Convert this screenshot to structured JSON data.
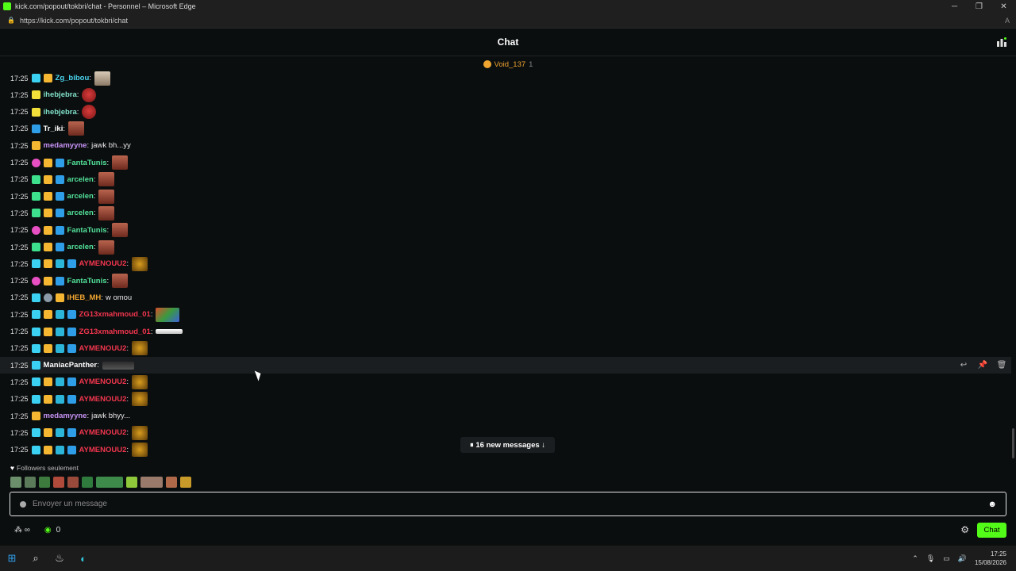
{
  "window": {
    "title": "kick.com/popout/tokbri/chat - Personnel – Microsoft Edge",
    "url": "https://kick.com/popout/tokbri/chat"
  },
  "chat": {
    "title": "Chat",
    "pinned_user": "Void_137",
    "pinned_count": "1"
  },
  "messages": [
    {
      "time": "17:25",
      "badges": [
        "b-sub",
        "b-gold"
      ],
      "user": "Zg_bibou",
      "color": "#4ad6f0",
      "text": "",
      "emote": "pale"
    },
    {
      "time": "17:25",
      "badges": [
        "b-yellow"
      ],
      "user": "ihebjebra",
      "color": "#7fe0c8",
      "text": "",
      "emote": "red"
    },
    {
      "time": "17:25",
      "badges": [
        "b-yellow"
      ],
      "user": "ihebjebra",
      "color": "#7fe0c8",
      "text": "",
      "emote": "red"
    },
    {
      "time": "17:25",
      "badges": [
        "b-blue"
      ],
      "user": "Tr_iki",
      "color": "#ffffff",
      "text": "",
      "emote": "face"
    },
    {
      "time": "17:25",
      "badges": [
        "b-gold"
      ],
      "user": "medamyyne",
      "color": "#c793f5",
      "text": "jawk bh...yy",
      "emote": ""
    },
    {
      "time": "17:25",
      "badges": [
        "b-pink",
        "b-gold",
        "b-blue"
      ],
      "user": "FantaTunis",
      "color": "#52e39a",
      "text": "",
      "emote": "face"
    },
    {
      "time": "17:25",
      "badges": [
        "b-green",
        "b-gold",
        "b-blue"
      ],
      "user": "arcelen",
      "color": "#52e39a",
      "text": "",
      "emote": "face"
    },
    {
      "time": "17:25",
      "badges": [
        "b-green",
        "b-gold",
        "b-blue"
      ],
      "user": "arcelen",
      "color": "#52e39a",
      "text": "",
      "emote": "face"
    },
    {
      "time": "17:25",
      "badges": [
        "b-green",
        "b-gold",
        "b-blue"
      ],
      "user": "arcelen",
      "color": "#52e39a",
      "text": "",
      "emote": "face"
    },
    {
      "time": "17:25",
      "badges": [
        "b-pink",
        "b-gold",
        "b-blue"
      ],
      "user": "FantaTunis",
      "color": "#52e39a",
      "text": "",
      "emote": "face"
    },
    {
      "time": "17:25",
      "badges": [
        "b-green",
        "b-gold",
        "b-blue"
      ],
      "user": "arcelen",
      "color": "#52e39a",
      "text": "",
      "emote": "face"
    },
    {
      "time": "17:25",
      "badges": [
        "b-sub",
        "b-gold",
        "b-og",
        "b-blue"
      ],
      "user": "AYMENOUU2",
      "color": "#f2364e",
      "text": "",
      "emote": "gold"
    },
    {
      "time": "17:25",
      "badges": [
        "b-pink",
        "b-gold",
        "b-blue"
      ],
      "user": "FantaTunis",
      "color": "#52e39a",
      "text": "",
      "emote": "face"
    },
    {
      "time": "17:25",
      "badges": [
        "b-sub",
        "b-wing",
        "b-gold"
      ],
      "user": "IHEB_MH",
      "color": "#f0a531",
      "text": "w omou",
      "emote": ""
    },
    {
      "time": "17:25",
      "badges": [
        "b-sub",
        "b-gold",
        "b-og",
        "b-blue"
      ],
      "user": "ZG13xmahmoud_01",
      "color": "#f2364e",
      "text": "",
      "emote": "parrot"
    },
    {
      "time": "17:25",
      "badges": [
        "b-sub",
        "b-gold",
        "b-og",
        "b-blue"
      ],
      "user": "ZG13xmahmoud_01",
      "color": "#f2364e",
      "text": "",
      "emote": "bird"
    },
    {
      "time": "17:25",
      "badges": [
        "b-sub",
        "b-gold",
        "b-og",
        "b-blue"
      ],
      "user": "AYMENOUU2",
      "color": "#f2364e",
      "text": "",
      "emote": "gold"
    },
    {
      "time": "17:25",
      "badges": [
        "b-sub"
      ],
      "user": "ManiacPanther",
      "color": "#ffffff",
      "text": "",
      "emote": "dark",
      "hover": true
    },
    {
      "time": "17:25",
      "badges": [
        "b-sub",
        "b-gold",
        "b-og",
        "b-blue"
      ],
      "user": "AYMENOUU2",
      "color": "#f2364e",
      "text": "",
      "emote": "gold"
    },
    {
      "time": "17:25",
      "badges": [
        "b-sub",
        "b-gold",
        "b-og",
        "b-blue"
      ],
      "user": "AYMENOUU2",
      "color": "#f2364e",
      "text": "",
      "emote": "gold"
    },
    {
      "time": "17:25",
      "badges": [
        "b-gold"
      ],
      "user": "medamyyne",
      "color": "#c793f5",
      "text": "jawk bhyy...",
      "emote": ""
    },
    {
      "time": "17:25",
      "badges": [
        "b-sub",
        "b-gold",
        "b-og",
        "b-blue"
      ],
      "user": "AYMENOUU2",
      "color": "#f2364e",
      "text": "",
      "emote": "gold"
    },
    {
      "time": "17:25",
      "badges": [
        "b-sub",
        "b-gold",
        "b-og",
        "b-blue"
      ],
      "user": "AYMENOUU2",
      "color": "#f2364e",
      "text": "",
      "emote": "gold"
    }
  ],
  "new_messages": "16 new messages",
  "followers_only": "Followers seulement",
  "input": {
    "placeholder": "Envoyer un message"
  },
  "bottom": {
    "count": "0",
    "chat_button": "Chat"
  },
  "taskbar": {
    "time": "17:25",
    "date": "15/08/2026"
  }
}
